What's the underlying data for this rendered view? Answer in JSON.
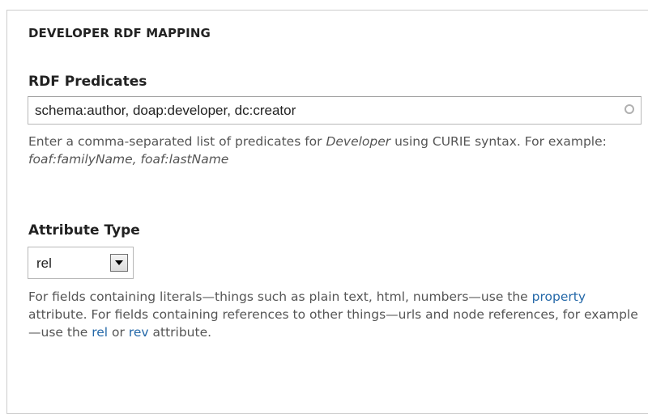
{
  "fieldset": {
    "legend": "DEVELOPER RDF MAPPING"
  },
  "predicates": {
    "label": "RDF Predicates",
    "value": "schema:author, doap:developer, dc:creator",
    "description_part1": "Enter a comma-separated list of predicates for ",
    "description_em1": "Developer",
    "description_part2": " using CURIE syntax. For example: ",
    "description_em2": "foaf:familyName, foaf:lastName"
  },
  "attribute_type": {
    "label": "Attribute Type",
    "selected": "rel",
    "description_part1": "For fields containing literals—things such as plain text, html, numbers—use the ",
    "link_property": "property",
    "description_part2": " attribute. For fields containing references to other things—urls and node references, for example—use the ",
    "link_rel": "rel",
    "description_or": " or ",
    "link_rev": "rev",
    "description_part3": " attribute."
  },
  "colors": {
    "link": "#2468a8",
    "border": "#cccccc"
  }
}
